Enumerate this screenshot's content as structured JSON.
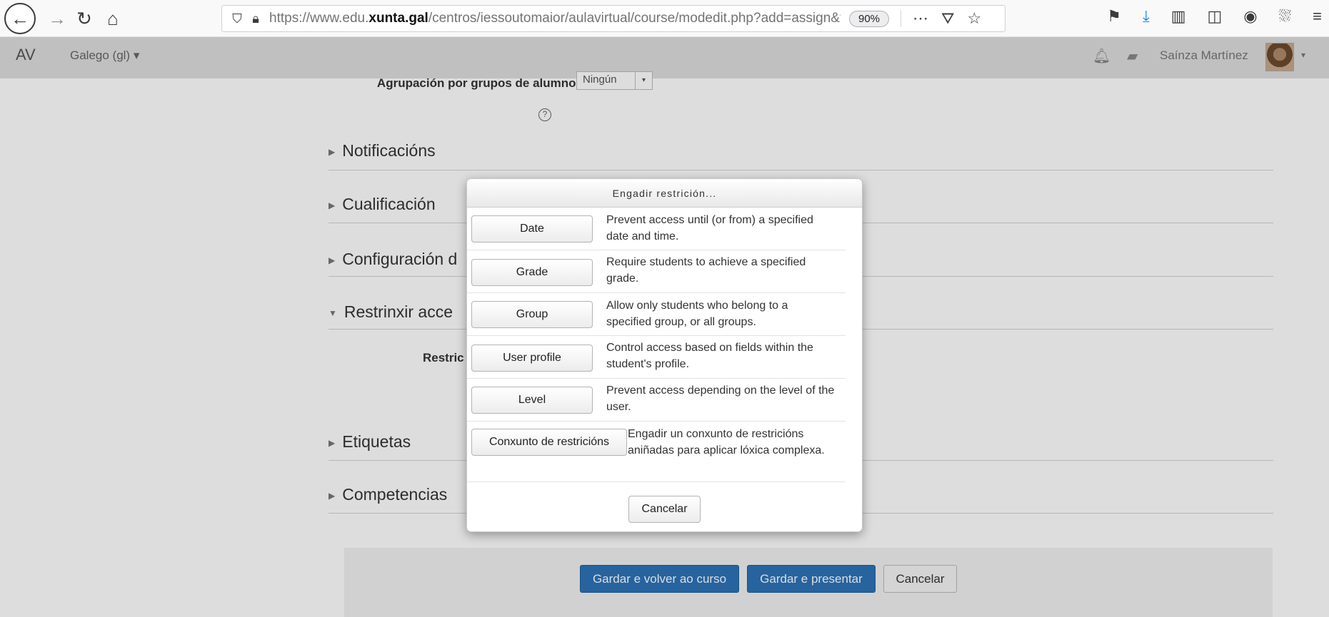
{
  "browser": {
    "url_prefix": "https://www.edu.",
    "url_domain": "xunta.gal",
    "url_path": "/centros/iessoutomaior/aulavirtual/course/modedit.php?add=assign&t",
    "zoom": "90%"
  },
  "navbar": {
    "brand": "AV",
    "language": "Galego (gl)",
    "username": "Saínza Martínez"
  },
  "form": {
    "grouping_label": "Agrupación por grupos de alumnos",
    "grouping_value": "Ningún",
    "sections": {
      "notifications": "Notificacións",
      "grade": "Cualificación",
      "config": "Configuración d",
      "restrict": "Restrinxir acce",
      "restrictions_label": "Restric",
      "tags": "Etiquetas",
      "competencies": "Competencias"
    },
    "buttons": {
      "save_return": "Gardar e volver ao curso",
      "save_show": "Gardar e presentar",
      "cancel": "Cancelar"
    }
  },
  "dialog": {
    "title": "Engadir restrición...",
    "options": [
      {
        "label": "Date",
        "description": "Prevent access until (or from) a specified date and time."
      },
      {
        "label": "Grade",
        "description": "Require students to achieve a specified grade."
      },
      {
        "label": "Group",
        "description": "Allow only students who belong to a specified group, or all groups."
      },
      {
        "label": "User profile",
        "description": "Control access based on fields within the student's profile."
      },
      {
        "label": "Level",
        "description": "Prevent access depending on the level of the user."
      },
      {
        "label": "Conxunto de restricións",
        "description": "Engadir un conxunto de restricións aniñadas para aplicar lóxica complexa."
      }
    ],
    "cancel": "Cancelar"
  }
}
